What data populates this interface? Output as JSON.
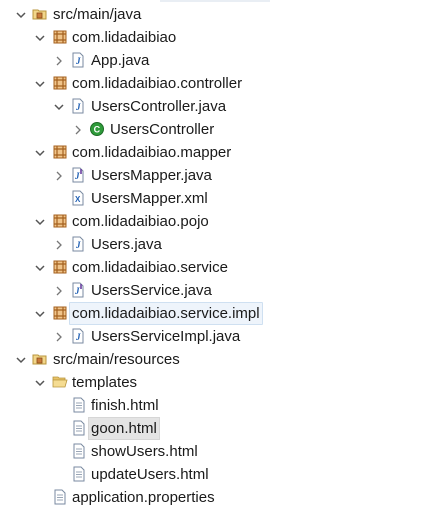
{
  "tree": {
    "items": [
      {
        "label": "src/main/java",
        "icon": "package-folder-icon",
        "expander": "expanded"
      },
      {
        "label": "com.lidadaibiao",
        "icon": "package-icon",
        "expander": "expanded"
      },
      {
        "label": "App.java",
        "icon": "java-file-icon",
        "expander": "collapsed"
      },
      {
        "label": "com.lidadaibiao.controller",
        "icon": "package-icon",
        "expander": "expanded"
      },
      {
        "label": "UsersController.java",
        "icon": "java-file-icon",
        "expander": "expanded"
      },
      {
        "label": "UsersController",
        "icon": "class-icon",
        "expander": "collapsed"
      },
      {
        "label": "com.lidadaibiao.mapper",
        "icon": "package-icon",
        "expander": "expanded"
      },
      {
        "label": "UsersMapper.java",
        "icon": "java-interface-file-icon",
        "expander": "collapsed"
      },
      {
        "label": "UsersMapper.xml",
        "icon": "xml-file-icon",
        "expander": "none"
      },
      {
        "label": "com.lidadaibiao.pojo",
        "icon": "package-icon",
        "expander": "expanded"
      },
      {
        "label": "Users.java",
        "icon": "java-file-icon",
        "expander": "collapsed"
      },
      {
        "label": "com.lidadaibiao.service",
        "icon": "package-icon",
        "expander": "expanded"
      },
      {
        "label": "UsersService.java",
        "icon": "java-interface-file-icon",
        "expander": "collapsed"
      },
      {
        "label": "com.lidadaibiao.service.impl",
        "icon": "package-icon",
        "expander": "expanded"
      },
      {
        "label": "UsersServiceImpl.java",
        "icon": "java-file-icon",
        "expander": "collapsed"
      },
      {
        "label": "src/main/resources",
        "icon": "package-folder-icon",
        "expander": "expanded"
      },
      {
        "label": "templates",
        "icon": "folder-open-icon",
        "expander": "expanded"
      },
      {
        "label": "finish.html",
        "icon": "text-file-icon",
        "expander": "none"
      },
      {
        "label": "goon.html",
        "icon": "text-file-icon",
        "expander": "none"
      },
      {
        "label": "showUsers.html",
        "icon": "text-file-icon",
        "expander": "none"
      },
      {
        "label": "updateUsers.html",
        "icon": "text-file-icon",
        "expander": "none"
      },
      {
        "label": "application.properties",
        "icon": "text-file-icon",
        "expander": "none"
      }
    ]
  },
  "colors": {
    "package": "#b5651d",
    "java_file": "#1f5fb4",
    "class_green": "#2e9b3a",
    "folder": "#e7c46a",
    "arrow": "#555555",
    "selection_outline": "#cfe0f1",
    "selection_gray": "#e4e4e4"
  }
}
